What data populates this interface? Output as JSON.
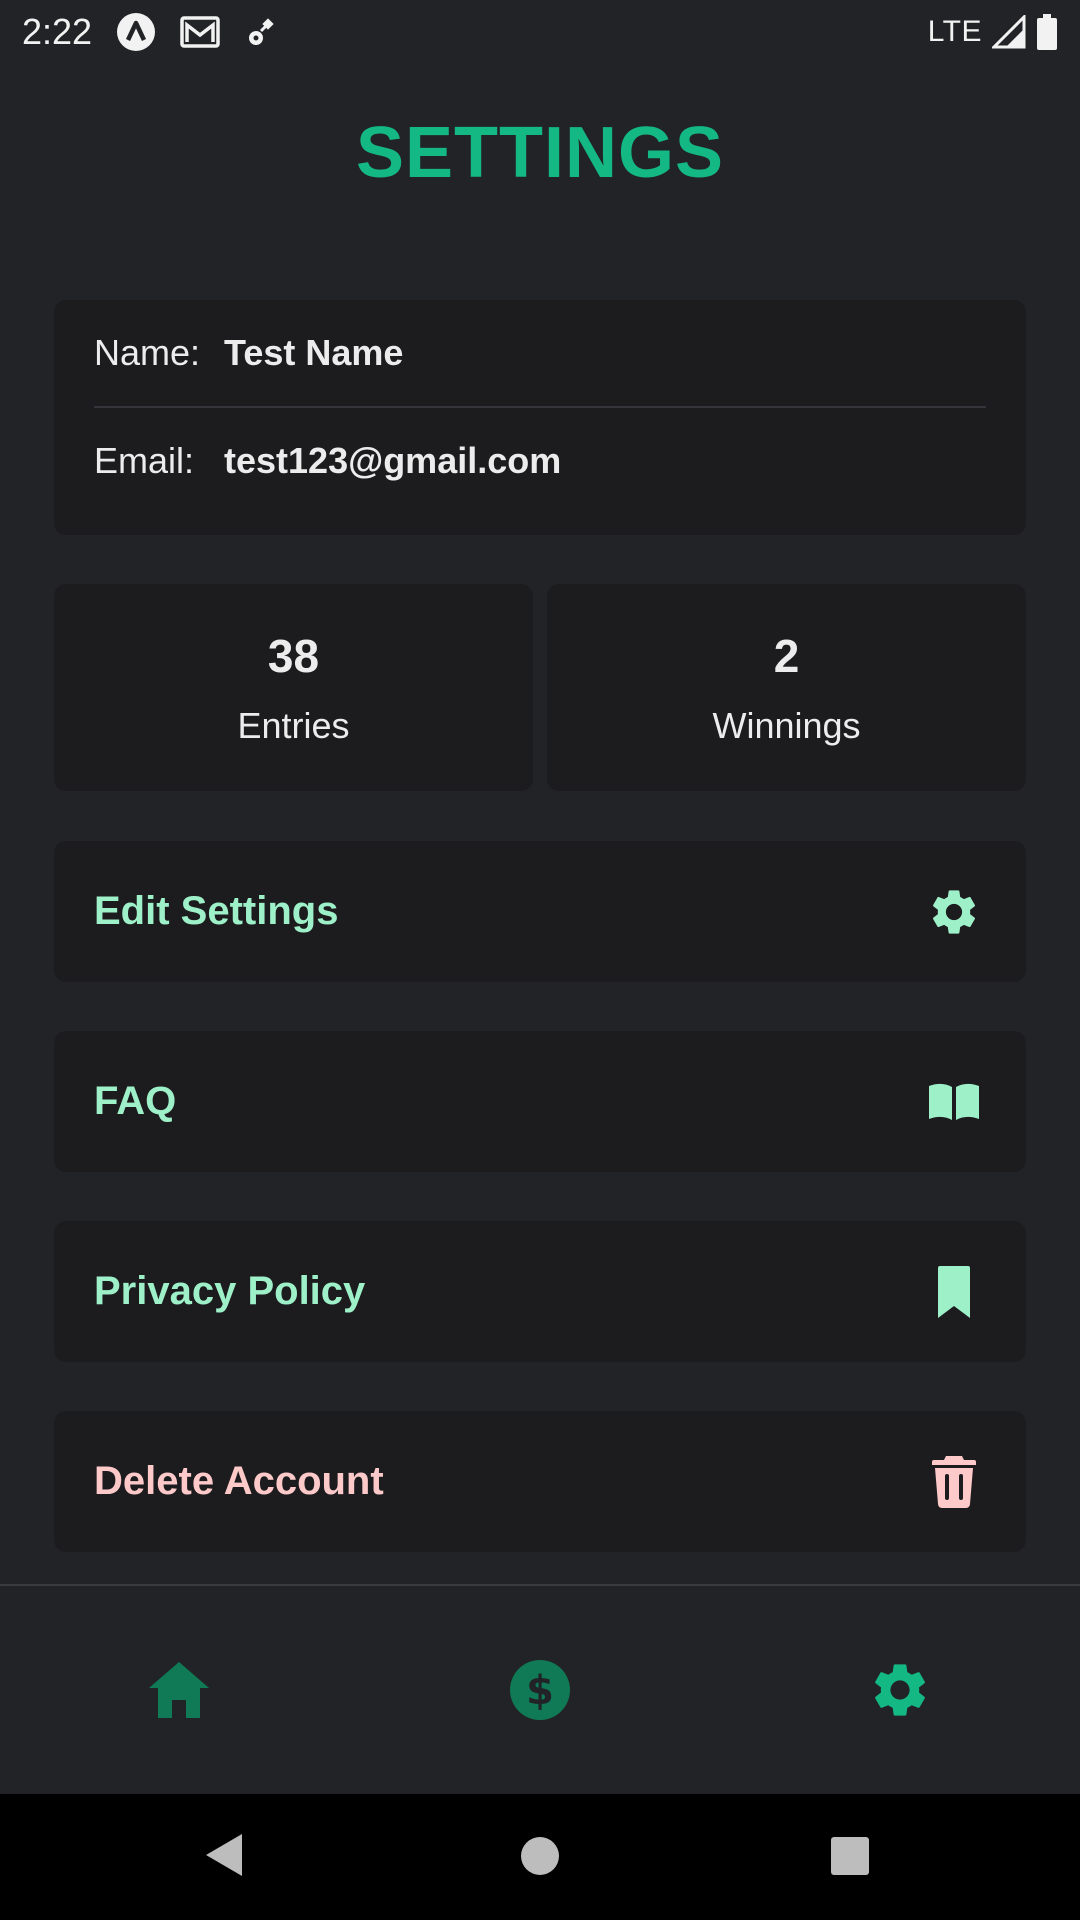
{
  "status_bar": {
    "time": "2:22",
    "network": "LTE",
    "icons": [
      "app-notification-icon",
      "gmail-icon",
      "satellite-icon",
      "signal-icon",
      "battery-icon"
    ]
  },
  "page": {
    "title": "SETTINGS"
  },
  "profile": {
    "name_label": "Name:",
    "name_value": "Test Name",
    "email_label": "Email:",
    "email_value": "test123@gmail.com"
  },
  "stats": {
    "entries": {
      "value": "38",
      "label": "Entries"
    },
    "winnings": {
      "value": "2",
      "label": "Winnings"
    }
  },
  "menu": {
    "edit_settings": {
      "label": "Edit Settings",
      "icon": "gear-icon"
    },
    "faq": {
      "label": "FAQ",
      "icon": "book-icon"
    },
    "privacy_policy": {
      "label": "Privacy Policy",
      "icon": "bookmark-icon"
    },
    "delete_account": {
      "label": "Delete Account",
      "icon": "trash-icon"
    }
  },
  "bottom_nav": {
    "items": [
      {
        "icon": "home-icon",
        "active": false
      },
      {
        "icon": "dollar-circle-icon",
        "active": false
      },
      {
        "icon": "gear-icon",
        "active": true
      }
    ]
  },
  "colors": {
    "accent": "#14b882",
    "accent_light": "#9ef0c9",
    "danger_light": "#fdc9c9",
    "background": "#222326",
    "card": "#1c1c1f",
    "nav_inactive": "#0f7a55"
  }
}
